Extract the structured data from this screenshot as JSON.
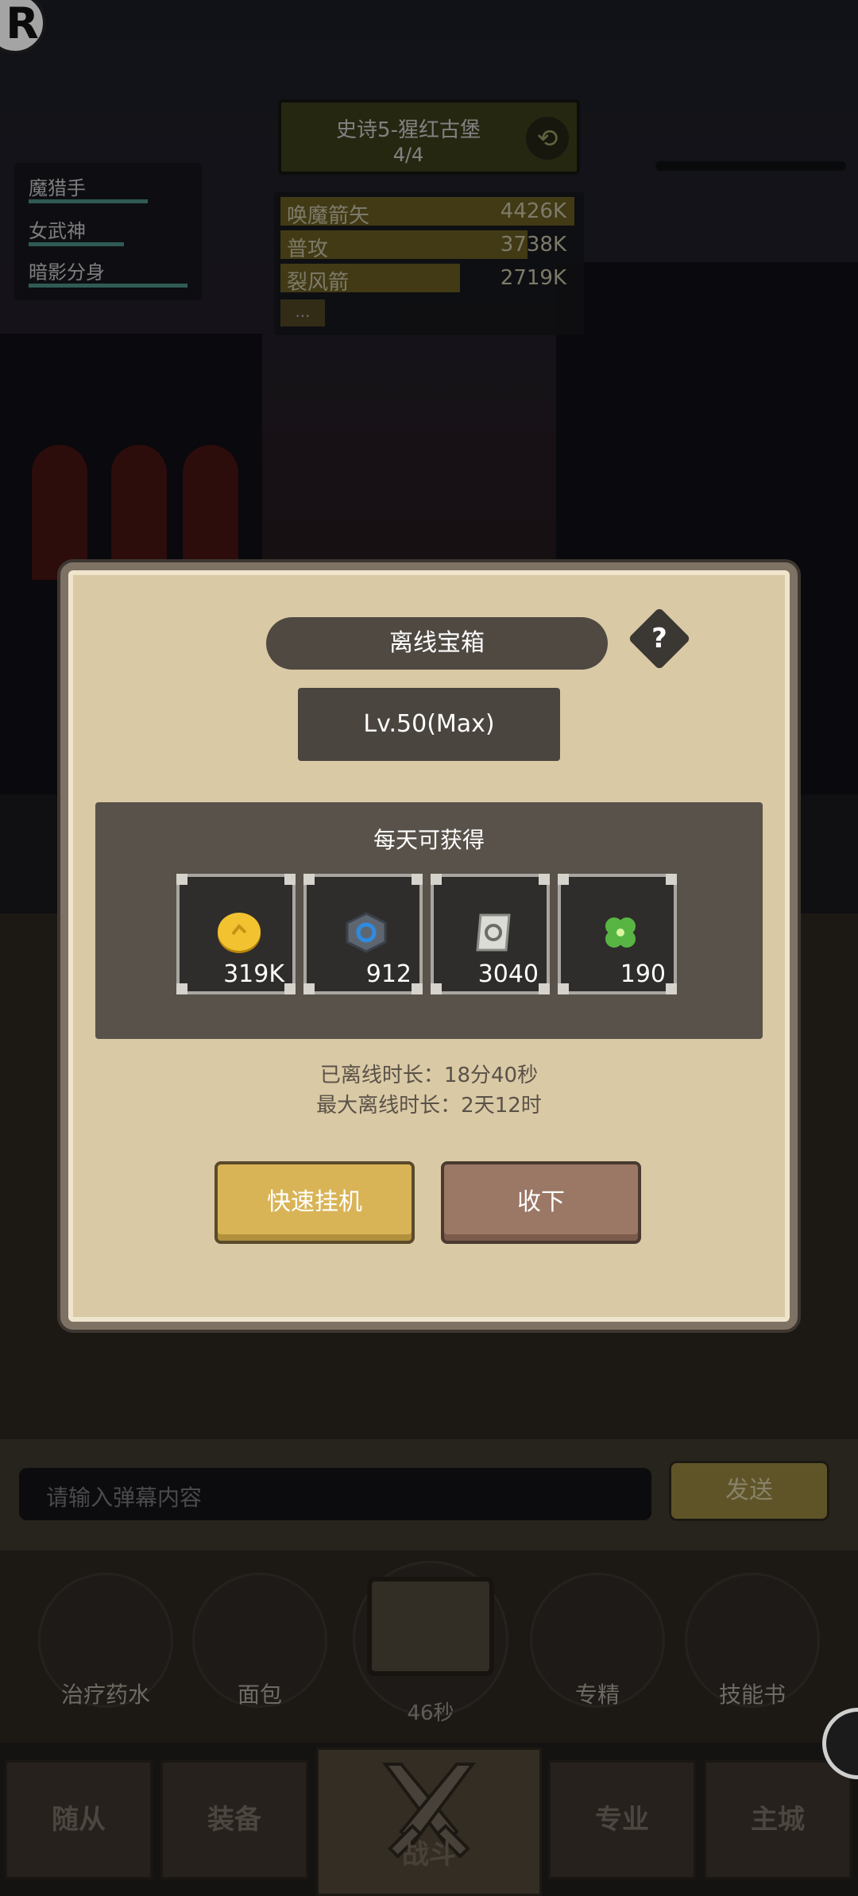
{
  "hud": {
    "app_badge": "R",
    "stage_title": "史诗5-猩红古堡",
    "stage_progress": "4/4",
    "heroes": [
      "魔猎手",
      "女武神",
      "暗影分身"
    ],
    "damage": [
      {
        "name": "唤魔箭矢",
        "value": "4426K",
        "fill": 1.0
      },
      {
        "name": "普攻",
        "value": "3738K",
        "fill": 0.84
      },
      {
        "name": "裂风箭",
        "value": "2719K",
        "fill": 0.61
      }
    ],
    "damage_more": "..."
  },
  "modal": {
    "title": "离线宝箱",
    "help": "?",
    "level": "Lv.50(Max)",
    "reward_heading": "每天可获得",
    "rewards": [
      {
        "icon": "gold-coin-icon",
        "count": "319K"
      },
      {
        "icon": "blue-gem-icon",
        "count": "912"
      },
      {
        "icon": "scroll-icon",
        "count": "3040"
      },
      {
        "icon": "clover-icon",
        "count": "190"
      }
    ],
    "offline_time": "已离线时长：18分40秒",
    "offline_max": "最大离线时长：2天12时",
    "quick_button": "快速挂机",
    "collect_button": "收下"
  },
  "chat": {
    "placeholder": "请输入弹幕内容",
    "send": "发送"
  },
  "items": [
    {
      "label": "治疗药水"
    },
    {
      "label": "面包"
    },
    {
      "label": "专精"
    },
    {
      "label": "技能书"
    }
  ],
  "chest_timer": "46秒",
  "nav": {
    "followers": "随从",
    "equipment": "装备",
    "fight": "战斗",
    "specialty": "专业",
    "city": "主城"
  },
  "colors": {
    "modal_bg": "#d9c9a5",
    "quick_button": "#d9b457",
    "collect_button": "#9b7765"
  }
}
